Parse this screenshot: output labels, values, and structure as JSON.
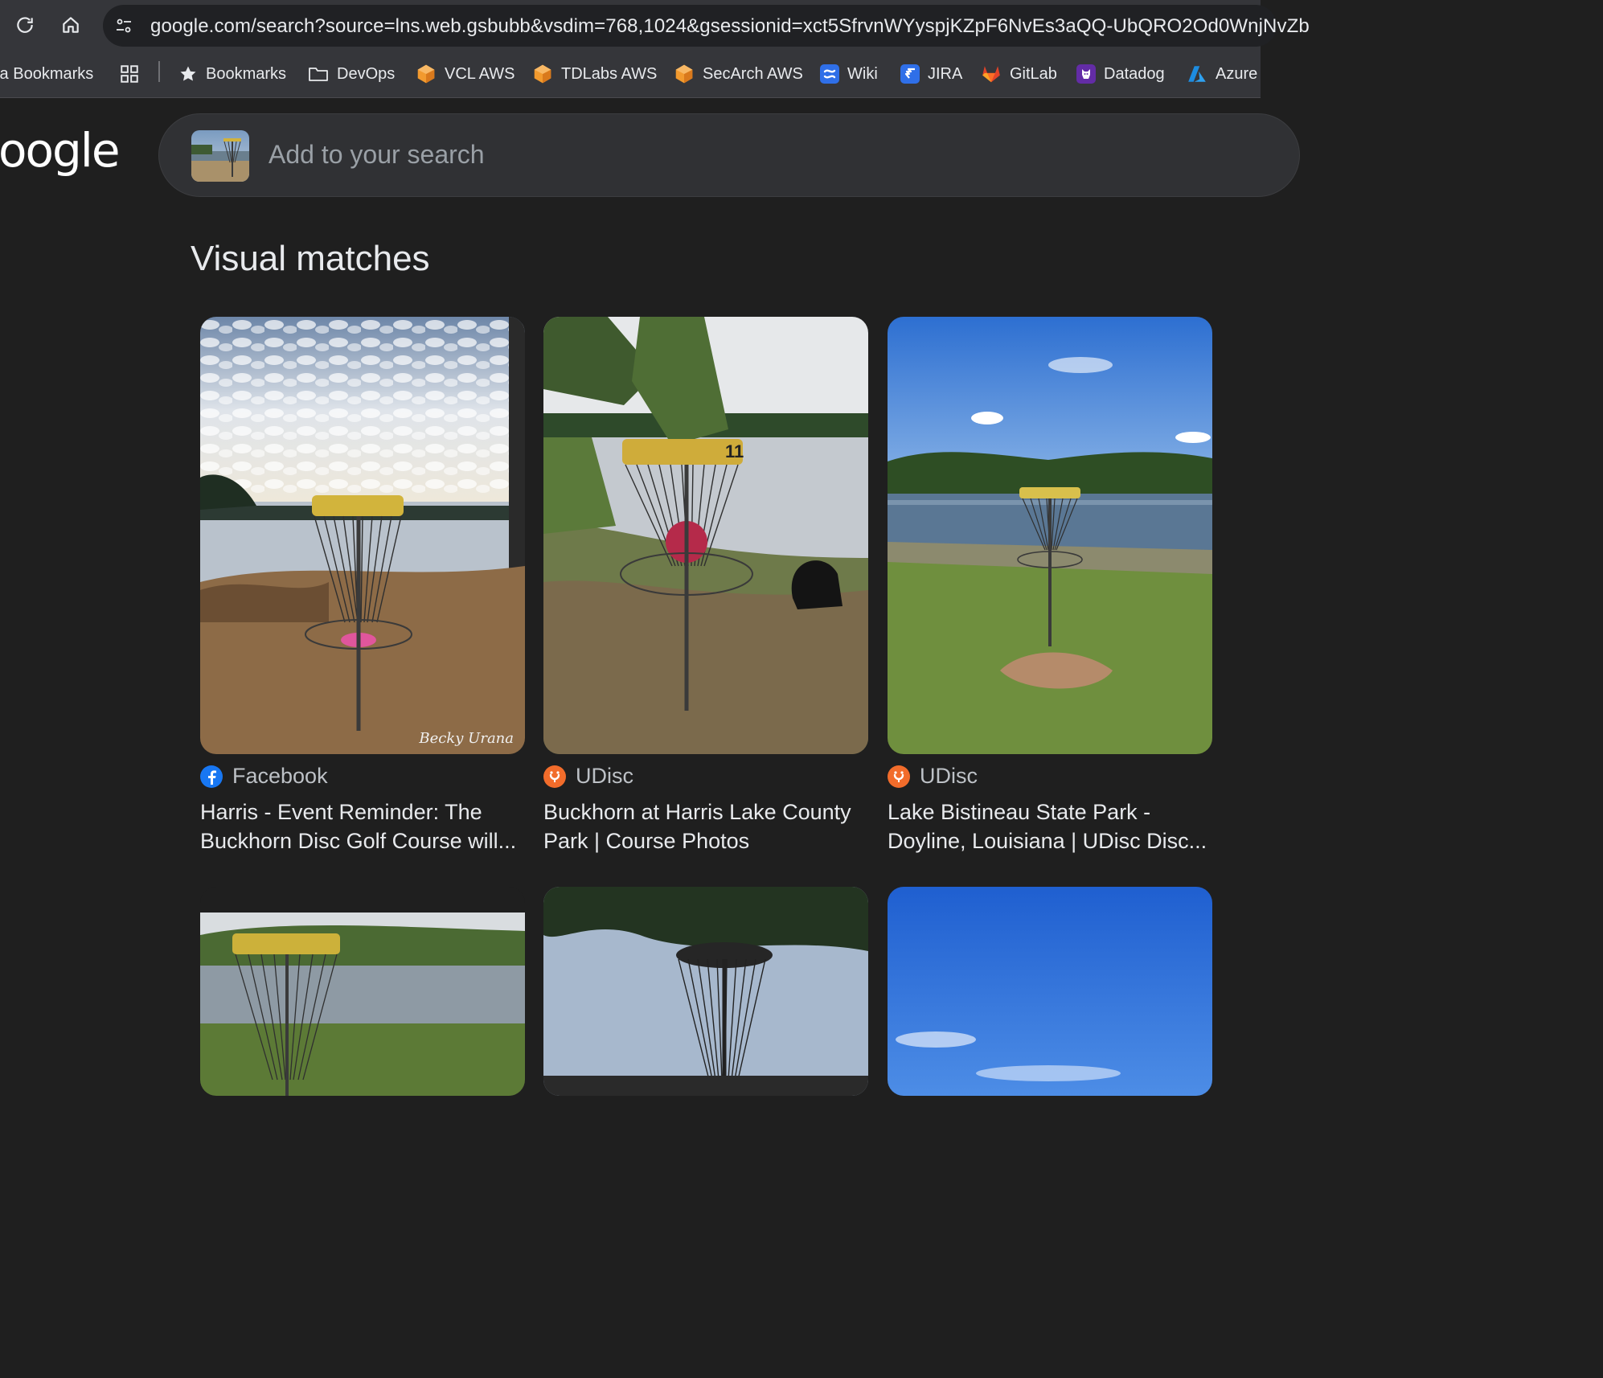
{
  "browser": {
    "url": "google.com/search?source=lns.web.gsbubb&vsdim=768,1024&gsessionid=xct5SfrvnWYyspjKZpF6NvEs3aQQ-UbQRO2Od0WnjNvZb",
    "bookmarks": [
      {
        "label": "ta Bookmarks",
        "icon": "none"
      },
      {
        "label": "",
        "icon": "apps-grid-icon"
      },
      {
        "label": "Bookmarks",
        "icon": "star-icon"
      },
      {
        "label": "DevOps",
        "icon": "folder-icon"
      },
      {
        "label": "VCL AWS",
        "icon": "aws-cube-icon"
      },
      {
        "label": "TDLabs AWS",
        "icon": "aws-cube-icon"
      },
      {
        "label": "SecArch AWS",
        "icon": "aws-cube-icon"
      },
      {
        "label": "Wiki",
        "icon": "confluence-icon"
      },
      {
        "label": "JIRA",
        "icon": "jira-icon"
      },
      {
        "label": "GitLab",
        "icon": "gitlab-icon"
      },
      {
        "label": "Datadog",
        "icon": "datadog-icon"
      },
      {
        "label": "Azure",
        "icon": "azure-icon"
      }
    ]
  },
  "page": {
    "logo_text": "oogle",
    "search_placeholder": "Add to your search",
    "section_title": "Visual matches"
  },
  "results": [
    {
      "source": "Facebook",
      "source_icon": "facebook-icon",
      "title_line1": "Harris - Event Reminder: The",
      "title_line2": "Buckhorn Disc Golf Course will...",
      "watermark": "Becky Urana"
    },
    {
      "source": "UDisc",
      "source_icon": "udisc-icon",
      "title_line1": "Buckhorn at Harris Lake County",
      "title_line2": "Park | Course Photos",
      "basket_number": "11"
    },
    {
      "source": "UDisc",
      "source_icon": "udisc-icon",
      "title_line1": "Lake Bistineau State Park -",
      "title_line2": "Doyline, Louisiana | UDisc Disc..."
    }
  ],
  "colors": {
    "chrome": "#35363a",
    "page_bg": "#1f1f1f",
    "search_bg": "#303134",
    "aws_orange": "#f29a2e",
    "atlassian_blue": "#2f6fe8",
    "gitlab_orange": "#e24329",
    "datadog_purple": "#632ca6",
    "azure_blue": "#1d8ce0",
    "facebook_blue": "#1877f2",
    "udisc_orange": "#f26c2b"
  }
}
